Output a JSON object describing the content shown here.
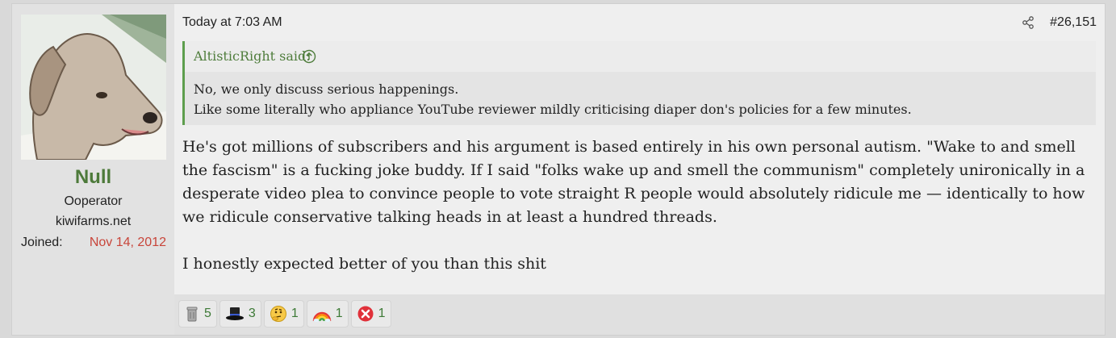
{
  "user": {
    "name": "Null",
    "title": "Ooperator",
    "domain": "kiwifarms.net",
    "joined_label": "Joined:",
    "joined_value": "Nov 14, 2012"
  },
  "post": {
    "date": "Today at 7:03 AM",
    "number": "#26,151",
    "quote": {
      "attribution": "AltisticRight said:",
      "lines": [
        "No, we only discuss serious happenings.",
        "Like some literally who appliance YouTube reviewer mildly criticising diaper don's policies for a few minutes."
      ]
    },
    "paragraphs": [
      "He's got millions of subscribers and his argument is based entirely in his own personal autism. \"Wake to and smell the fascism\" is a fucking joke buddy. If I said \"folks wake up and smell the communism\" completely unironically in a desperate video plea to convince people to vote straight R people would absolutely ridicule me — identically to how we ridicule conservative talking heads in at least a hundred threads.",
      "I honestly expected better of you than this shit"
    ]
  },
  "reactions": [
    {
      "icon": "trash-can-icon",
      "count": "5"
    },
    {
      "icon": "top-hat-icon",
      "count": "3"
    },
    {
      "icon": "thinking-face-icon",
      "count": "1"
    },
    {
      "icon": "rainbow-icon",
      "count": "1"
    },
    {
      "icon": "red-x-icon",
      "count": "1"
    }
  ],
  "colors": {
    "accent": "#4d7a3a",
    "joined": "#c8453a",
    "quote_border": "#5d9e4d"
  }
}
